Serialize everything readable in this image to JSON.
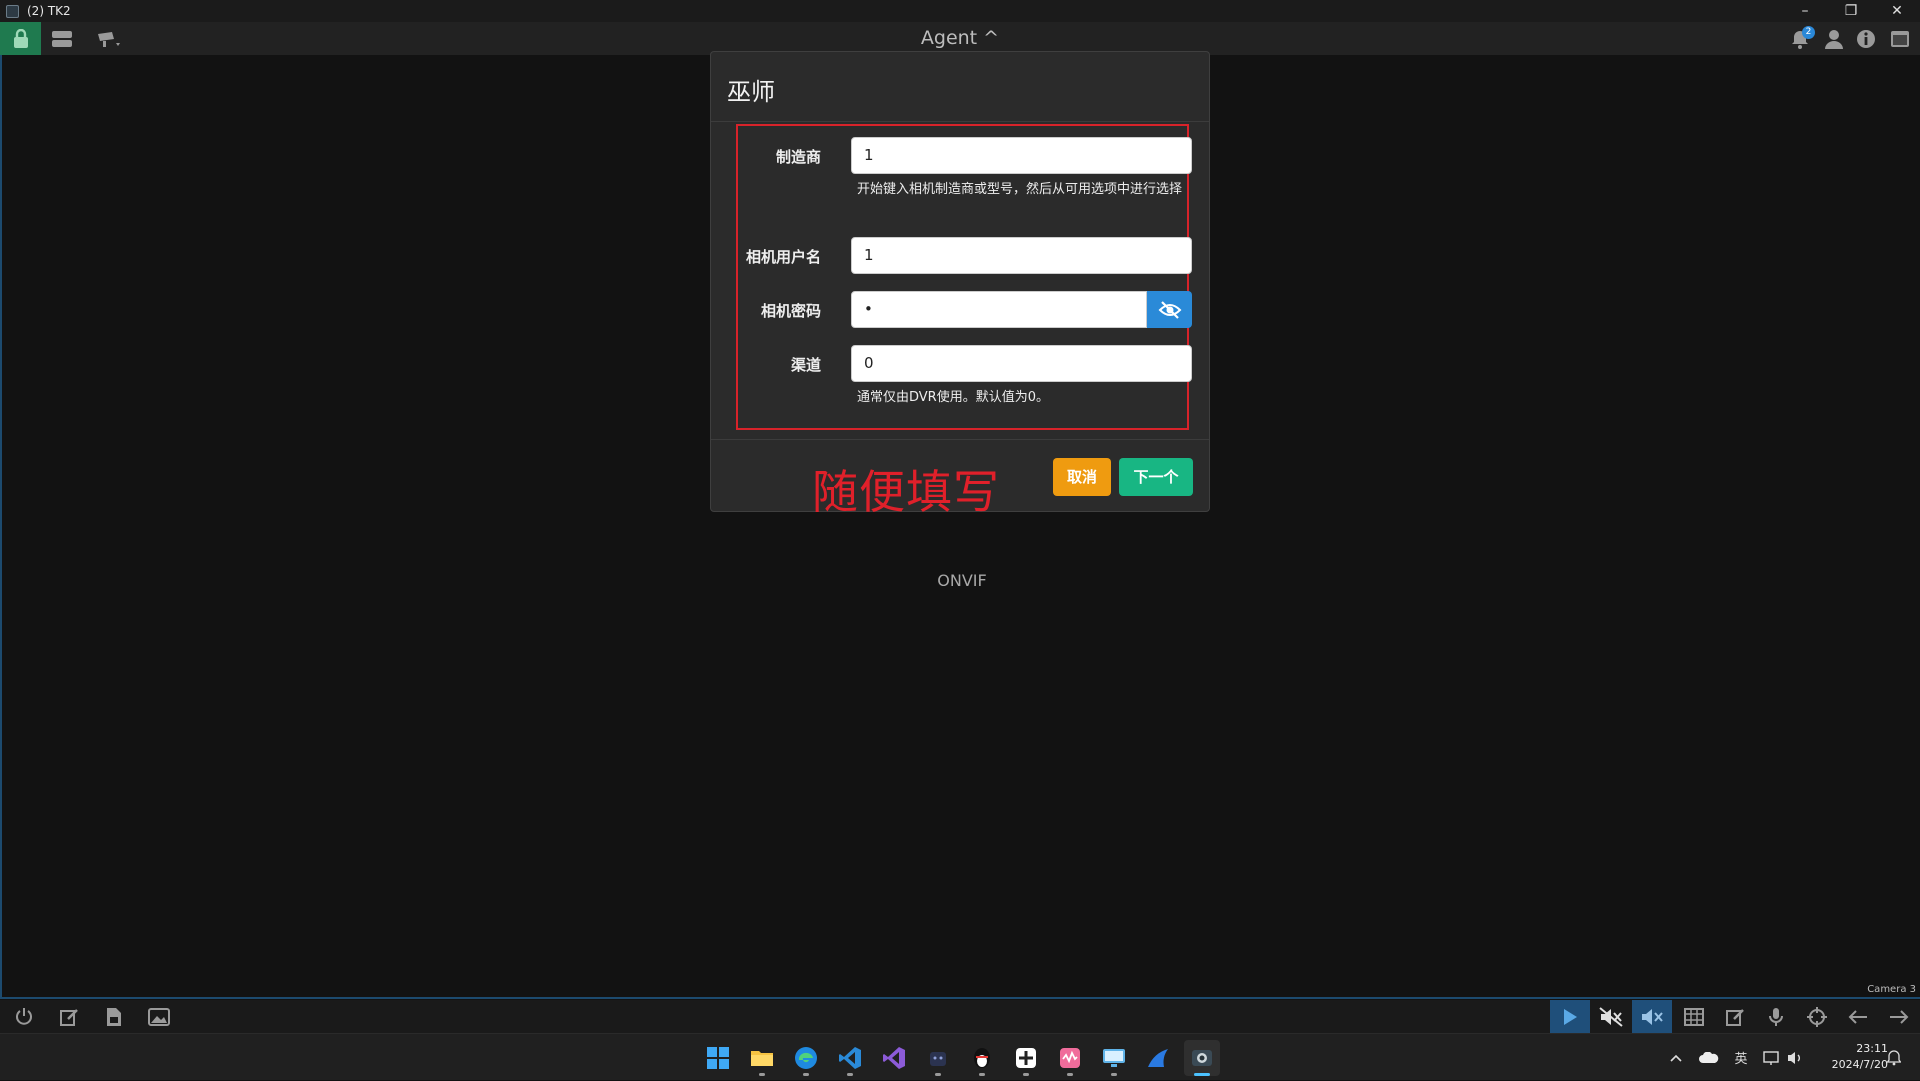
{
  "window": {
    "title": "(2) TK2",
    "minimize": "–",
    "restore": "❐",
    "close": "✕"
  },
  "toolbar": {
    "agent_label": "Agent ^",
    "notification_count": "2",
    "icons": [
      "lock-icon",
      "server-icon",
      "camera-icon",
      "bell-icon",
      "user-icon",
      "info-icon",
      "window-icon"
    ]
  },
  "dialog": {
    "title": "巫师",
    "fields": {
      "manufacturer": {
        "label": "制造商",
        "value": "1",
        "help": "开始键入相机制造商或型号，然后从可用选项中进行选择"
      },
      "username": {
        "label": "相机用户名",
        "value": "1"
      },
      "password": {
        "label": "相机密码",
        "value": "•"
      },
      "channel": {
        "label": "渠道",
        "value": "0",
        "help": "通常仅由DVR使用。默认值为0。"
      }
    },
    "annotation": "随便填写",
    "cancel_label": "取消",
    "next_label": "下一个"
  },
  "viewport": {
    "onvif_label": "ONVIF",
    "camera_label": "Camera 3"
  },
  "colors": {
    "accent_blue": "#2a8ad8",
    "lock_green": "#1f7a4f",
    "cancel_orange": "#ef9b10",
    "next_green": "#18b683",
    "annotation_red": "#e0202a"
  },
  "taskbar": {
    "apps": [
      "windows-start",
      "file-explorer",
      "edge",
      "vscode",
      "visual-studio",
      "app-dark",
      "qq",
      "app-plus",
      "app-pink",
      "app-monitor",
      "app-blue",
      "agent-dvr"
    ],
    "ime": "英",
    "time": "23:11",
    "date": "2024/7/20"
  }
}
